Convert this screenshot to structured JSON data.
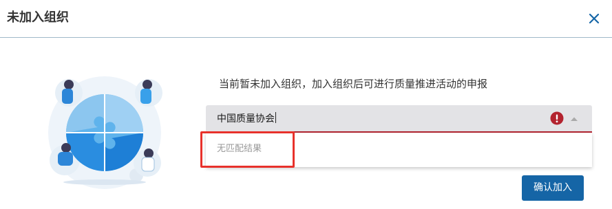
{
  "dialog": {
    "title": "未加入组织",
    "close_icon": "close-icon"
  },
  "content": {
    "description": "当前暂未加入组织，加入组织后可进行质量推进活动的申报",
    "illustration": "team-puzzle-illustration"
  },
  "org_select": {
    "value": "中国质量协会",
    "status_icon": "error-icon",
    "toggle_icon": "chevron-up-icon",
    "state": "error",
    "dropdown_open": true,
    "no_match_text": "无匹配结果"
  },
  "actions": {
    "confirm_label": "确认加入"
  },
  "colors": {
    "primary": "#1565a6",
    "error": "#b3232f",
    "highlight": "#e8312b",
    "field_bg": "#e3e3e6"
  }
}
